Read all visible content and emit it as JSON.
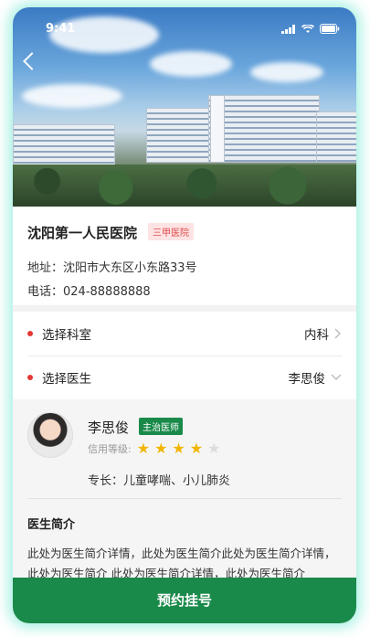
{
  "status_bar": {
    "time": "9:41"
  },
  "hospital": {
    "name": "沈阳第一人民医院",
    "level_badge": "三甲医院",
    "address": "地址：沈阳市大东区小东路33号",
    "phone": "电话：024-88888888"
  },
  "selection": {
    "department_label": "选择科室",
    "department_value": "内科",
    "doctor_label": "选择医生",
    "doctor_value": "李思俊"
  },
  "doctor": {
    "name": "李思俊",
    "title_badge": "主治医师",
    "credit_label": "信用等级:",
    "credit_rating": 4,
    "credit_max": 5,
    "specialty": "专长：儿童哮喘、小儿肺炎",
    "intro_heading": "医生简介",
    "intro_text": "此处为医生简介详情，此处为医生简介此处为医生简介详情，此处为医生简介 此处为医生简介详情，此处为医生简介"
  },
  "book_button": "预约挂号",
  "colors": {
    "accent": "#1a8a4a",
    "required_dot": "#e53935",
    "star": "#f2b600"
  }
}
